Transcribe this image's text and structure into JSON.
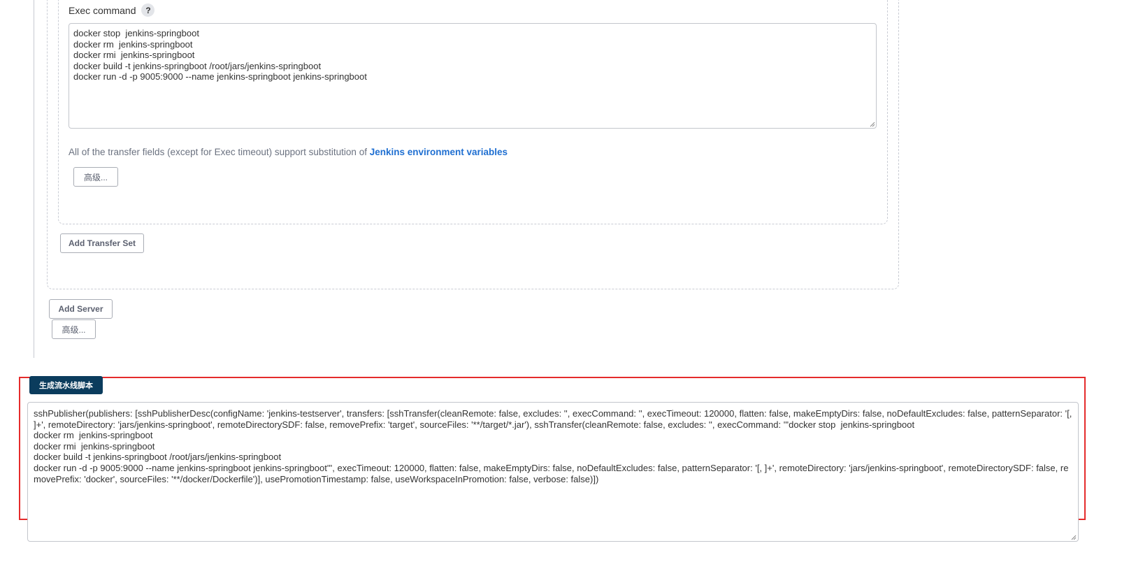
{
  "exec": {
    "label": "Exec command",
    "help_glyph": "?",
    "command": "docker stop  jenkins-springboot\ndocker rm  jenkins-springboot\ndocker rmi  jenkins-springboot\ndocker build -t jenkins-springboot /root/jars/jenkins-springboot\ndocker run -d -p 9005:9000 --name jenkins-springboot jenkins-springboot"
  },
  "note": {
    "text": "All of the transfer fields (except for Exec timeout) support substitution of ",
    "link": "Jenkins environment variables"
  },
  "buttons": {
    "advanced_transfer": "高级...",
    "add_transfer_set": "Add Transfer Set",
    "add_server": "Add Server",
    "advanced_server": "高级...",
    "generate_script": "生成流水线脚本"
  },
  "script": {
    "text": "sshPublisher(publishers: [sshPublisherDesc(configName: 'jenkins-testserver', transfers: [sshTransfer(cleanRemote: false, excludes: '', execCommand: '', execTimeout: 120000, flatten: false, makeEmptyDirs: false, noDefaultExcludes: false, patternSeparator: '[, ]+', remoteDirectory: 'jars/jenkins-springboot', remoteDirectorySDF: false, removePrefix: 'target', sourceFiles: '**/target/*.jar'), sshTransfer(cleanRemote: false, excludes: '', execCommand: '''docker stop  jenkins-springboot\ndocker rm  jenkins-springboot\ndocker rmi  jenkins-springboot\ndocker build -t jenkins-springboot /root/jars/jenkins-springboot\ndocker run -d -p 9005:9000 --name jenkins-springboot jenkins-springboot''', execTimeout: 120000, flatten: false, makeEmptyDirs: false, noDefaultExcludes: false, patternSeparator: '[, ]+', remoteDirectory: 'jars/jenkins-springboot', remoteDirectorySDF: false, removePrefix: 'docker', sourceFiles: '**/docker/Dockerfile')], usePromotionTimestamp: false, useWorkspaceInPromotion: false, verbose: false)])"
  },
  "colors": {
    "highlight_border": "#e52b2b",
    "primary_button": "#0b3c5d",
    "link": "#1f6fd1"
  }
}
